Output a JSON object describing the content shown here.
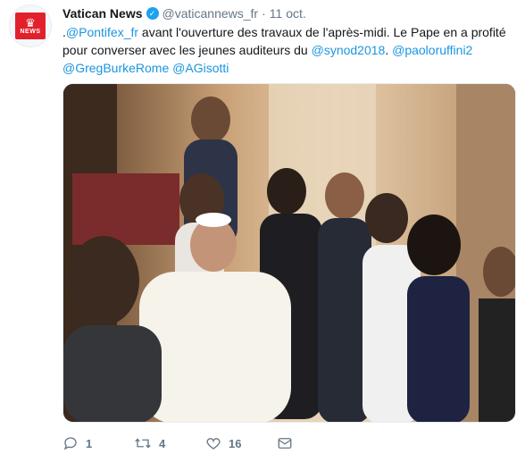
{
  "tweet": {
    "author_name": "Vatican News",
    "handle": "@vaticannews_fr",
    "separator": "·",
    "time": "11 oct.",
    "avatar_label": "NEWS",
    "text_parts": [
      {
        "type": "text",
        "value": "."
      },
      {
        "type": "mention",
        "value": "@Pontifex_fr"
      },
      {
        "type": "text",
        "value": " avant l'ouverture des travaux de l'après-midi. Le Pape en a profité pour converser avec les jeunes auditeurs du "
      },
      {
        "type": "mention",
        "value": "@synod2018"
      },
      {
        "type": "text",
        "value": ". "
      },
      {
        "type": "mention",
        "value": "@paoloruffini2"
      },
      {
        "type": "text",
        "value": " "
      },
      {
        "type": "mention",
        "value": "@GregBurkeRome"
      },
      {
        "type": "text",
        "value": " "
      },
      {
        "type": "mention",
        "value": "@AGisotti"
      }
    ],
    "photo_description_icon": "photo"
  },
  "actions": {
    "reply_count": "1",
    "retweet_count": "4",
    "like_count": "16",
    "reply_icon": "reply-icon",
    "retweet_icon": "retweet-icon",
    "like_icon": "heart-icon",
    "dm_icon": "envelope-icon"
  },
  "colors": {
    "brand_red": "#e2202c",
    "link_blue": "#1b95e0",
    "verified_blue": "#1da1f2",
    "muted_gray": "#657786"
  }
}
